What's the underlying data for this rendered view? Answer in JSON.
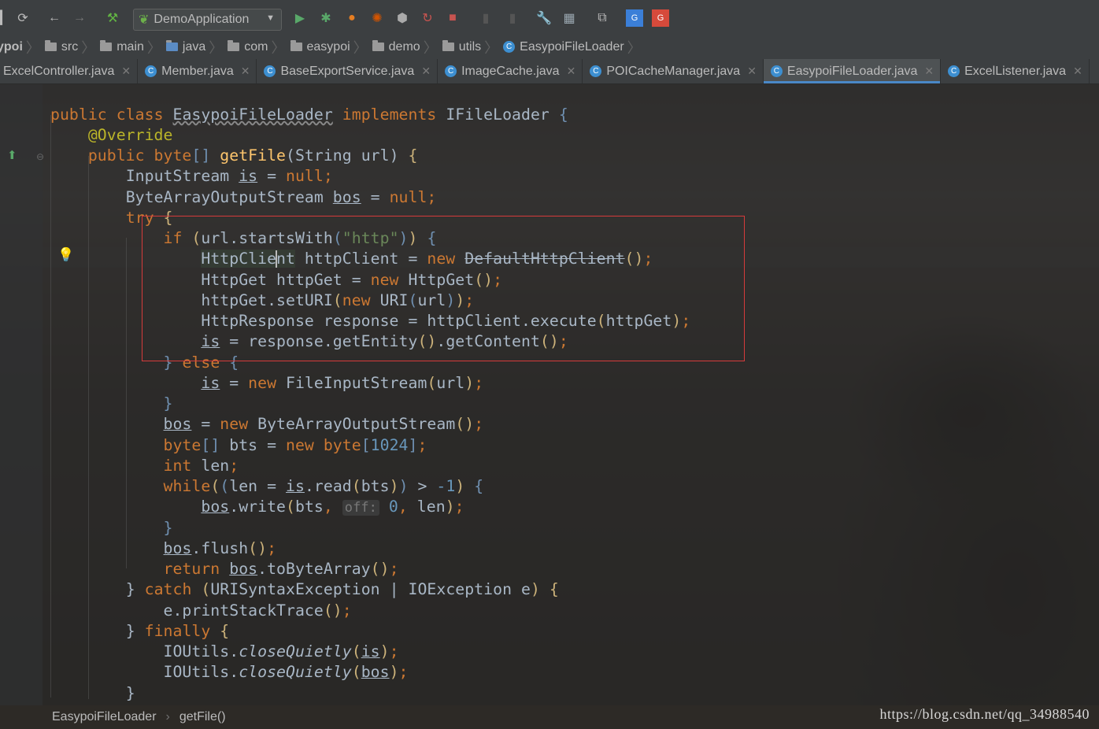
{
  "toolbar": {
    "run_config": "DemoApplication"
  },
  "breadcrumbs": [
    "ypoi",
    "src",
    "main",
    "java",
    "com",
    "easypoi",
    "demo",
    "utils",
    "EasypoiFileLoader"
  ],
  "tabs": [
    {
      "label": "ExcelController.java",
      "active": false
    },
    {
      "label": "Member.java",
      "active": false
    },
    {
      "label": "BaseExportService.java",
      "active": false
    },
    {
      "label": "ImageCache.java",
      "active": false
    },
    {
      "label": "POICacheManager.java",
      "active": false
    },
    {
      "label": "EasypoiFileLoader.java",
      "active": true
    },
    {
      "label": "ExcelListener.java",
      "active": false
    }
  ],
  "code": {
    "kw_public": "public",
    "kw_class": "class",
    "class_name": "EasypoiFileLoader",
    "kw_implements": "implements",
    "iface": "IFileLoader",
    "annotation": "@Override",
    "method_sig_tail": "(String url)",
    "method_name": "getFile",
    "local_is": "is",
    "local_bos": "bos",
    "str_http": "\"http\"",
    "deprecated_client": "DefaultHttpClient",
    "num_1024": "1024",
    "hint_off": "off:",
    "num_0": "0",
    "num_minus1": "-1",
    "fn_close": "closeQuietly"
  },
  "status": {
    "path_class": "EasypoiFileLoader",
    "path_method": "getFile()"
  },
  "watermark": "https://blog.csdn.net/qq_34988540",
  "colors": {
    "keyword": "#cc7832",
    "string": "#6a8759",
    "number": "#6897bb",
    "method": "#ffc66d",
    "annotation": "#bbb529",
    "highlight_box": "#d63b3b"
  }
}
